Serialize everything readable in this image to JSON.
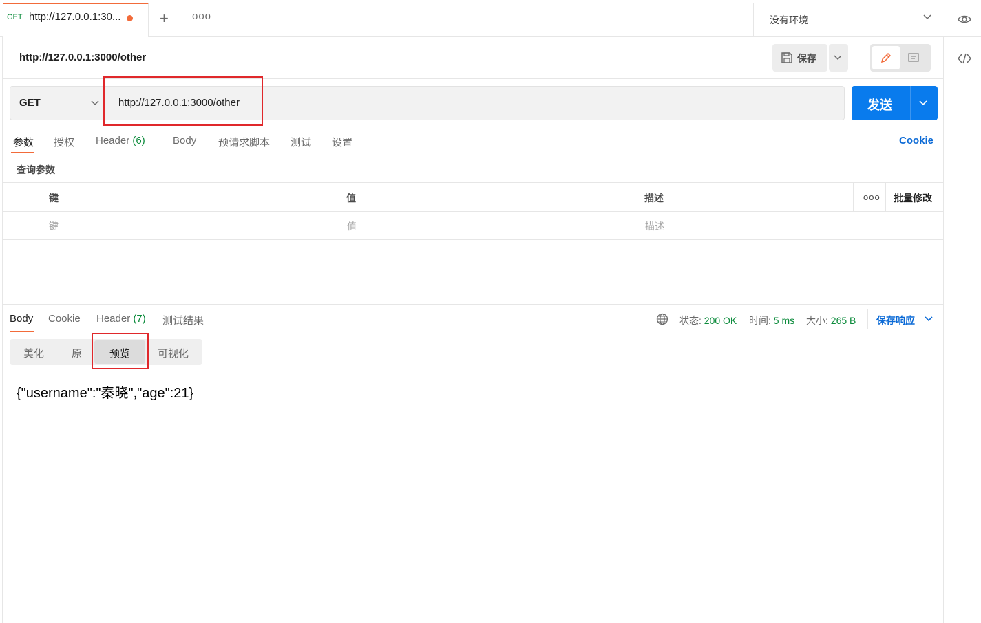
{
  "tab": {
    "method": "GET",
    "title": "http://127.0.0.1:30...",
    "plus": "+",
    "more": "ooo"
  },
  "environment": {
    "label": "没有环境"
  },
  "request": {
    "title": "http://127.0.0.1:3000/other",
    "save_label": "保存",
    "method": "GET",
    "url": "http://127.0.0.1:3000/other",
    "send_label": "发送"
  },
  "request_tabs": {
    "params": "参数",
    "auth": "授权",
    "header": "Header",
    "header_count": "(6)",
    "body": "Body",
    "prerequest": "预请求脚本",
    "tests": "测试",
    "settings": "设置",
    "cookie": "Cookie"
  },
  "params": {
    "section_label": "查询参数",
    "columns": {
      "key": "键",
      "value": "值",
      "description": "描述",
      "more": "ooo",
      "bulk_edit": "批量修改"
    },
    "placeholders": {
      "key": "键",
      "value": "值",
      "description": "描述"
    }
  },
  "response": {
    "tabs": {
      "body": "Body",
      "cookie": "Cookie",
      "header": "Header",
      "header_count": "(7)",
      "test_results": "测试结果"
    },
    "status_label": "状态:",
    "status_value": "200 OK",
    "time_label": "时间:",
    "time_value": "5 ms",
    "size_label": "大小:",
    "size_value": "265 B",
    "save_response": "保存响应",
    "view_modes": {
      "pretty": "美化",
      "raw": "原",
      "preview": "预览",
      "visualize": "可视化"
    },
    "body_text": "{\"username\":\"秦晓\",\"age\":21}"
  },
  "colors": {
    "accent": "#f26b3a",
    "send": "#097bed",
    "link": "#0b6ad6",
    "status_ok": "#0a8a3a",
    "highlight": "#e0282b"
  }
}
